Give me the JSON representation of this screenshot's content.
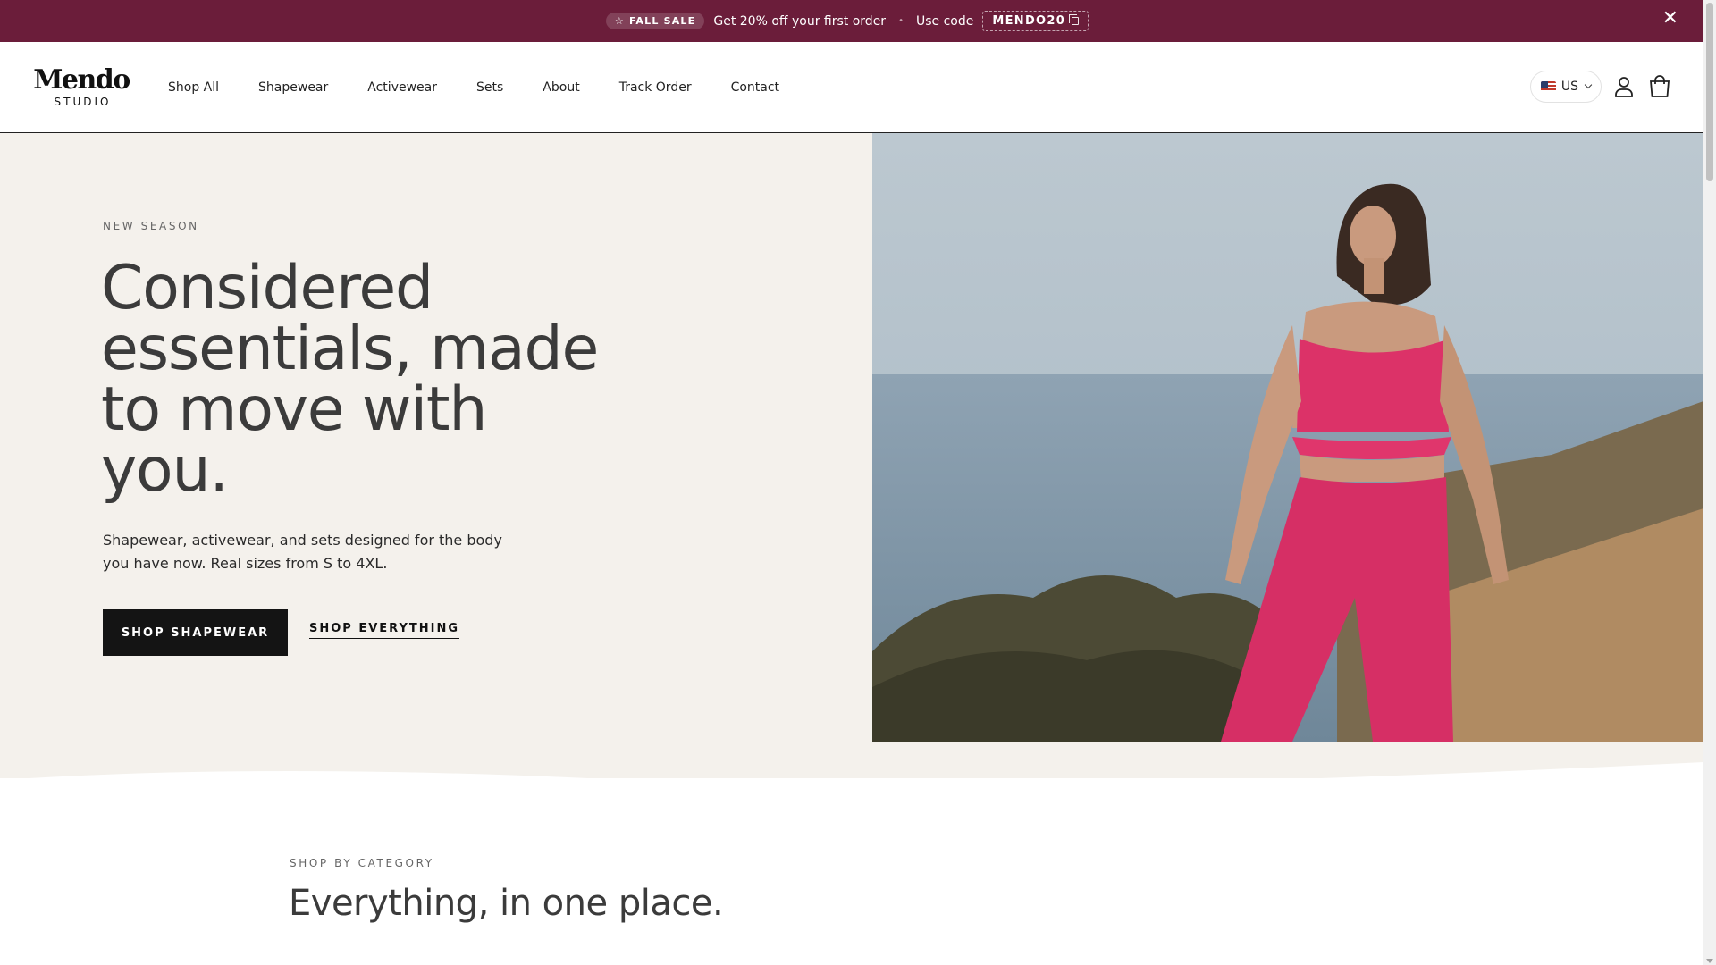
{
  "announcement": {
    "badge": "FALL SALE",
    "message": "Get 20% off your first order",
    "code_prefix": "Use code",
    "code": "MENDO20",
    "bg_color": "#6b1d3a"
  },
  "header": {
    "logo_main": "Mendo",
    "logo_sub": "STUDIO",
    "nav": [
      "Shop All",
      "Shapewear",
      "Activewear",
      "Sets",
      "About",
      "Track Order",
      "Contact"
    ],
    "locale": "US"
  },
  "hero": {
    "eyebrow": "NEW SEASON",
    "title": "Considered essentials, made to move with you.",
    "subtitle": "Shapewear, activewear, and sets designed for the body you have now. Real sizes from S to 4XL.",
    "primary_cta": "SHOP SHAPEWEAR",
    "secondary_cta": "SHOP EVERYTHING",
    "bg_color": "#f4f1ec"
  },
  "category": {
    "eyebrow": "SHOP BY CATEGORY",
    "title": "Everything, in one place."
  }
}
